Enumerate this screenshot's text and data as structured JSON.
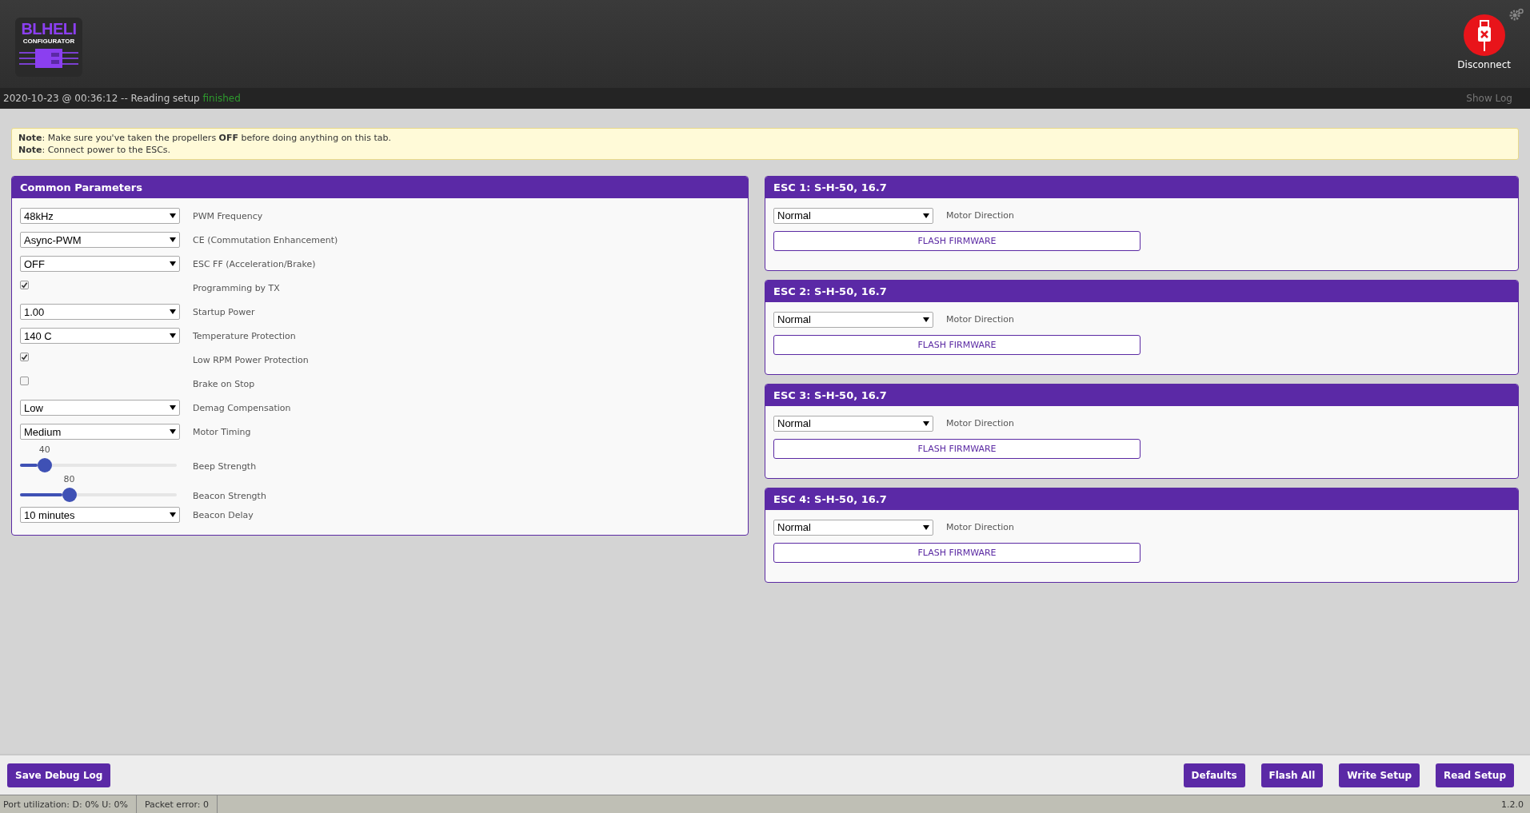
{
  "logo": {
    "title": "BLHELI",
    "subtitle": "CONFIGURATOR"
  },
  "connect_button": {
    "label": "Disconnect"
  },
  "log": {
    "text": "2020-10-23 @ 00:36:12 -- Reading setup",
    "status": "finished",
    "toggle": "Show Log"
  },
  "notes": [
    "**Note**: Make sure you've taken the propellers **OFF** before doing anything on this tab.",
    "**Note**: Connect power to the ESCs."
  ],
  "common": {
    "title": "Common Parameters",
    "params": [
      {
        "kind": "select",
        "value": "48kHz",
        "label": "PWM Frequency"
      },
      {
        "kind": "select",
        "value": "Async-PWM",
        "label": "CE (Commutation Enhancement)"
      },
      {
        "kind": "select",
        "value": "OFF",
        "label": "ESC FF (Acceleration/Brake)"
      },
      {
        "kind": "checkbox",
        "checked": true,
        "label": "Programming by TX"
      },
      {
        "kind": "select",
        "value": "1.00",
        "label": "Startup Power"
      },
      {
        "kind": "select",
        "value": "140 C",
        "label": "Temperature Protection"
      },
      {
        "kind": "checkbox",
        "checked": true,
        "label": "Low RPM Power Protection"
      },
      {
        "kind": "checkbox",
        "checked": false,
        "label": "Brake on Stop"
      },
      {
        "kind": "select",
        "value": "Low",
        "label": "Demag Compensation"
      },
      {
        "kind": "select",
        "value": "Medium",
        "label": "Motor Timing"
      },
      {
        "kind": "slider",
        "value": "40",
        "level": 0.157,
        "label": "Beep Strength"
      },
      {
        "kind": "slider",
        "value": "80",
        "level": 0.314,
        "label": "Beacon Strength"
      },
      {
        "kind": "select",
        "value": "10 minutes",
        "label": "Beacon Delay"
      }
    ]
  },
  "escs": [
    {
      "title": "ESC 1: S-H-50, 16.7",
      "direction": "Normal",
      "direction_label": "Motor Direction",
      "flash": "FLASH FIRMWARE"
    },
    {
      "title": "ESC 2: S-H-50, 16.7",
      "direction": "Normal",
      "direction_label": "Motor Direction",
      "flash": "FLASH FIRMWARE"
    },
    {
      "title": "ESC 3: S-H-50, 16.7",
      "direction": "Normal",
      "direction_label": "Motor Direction",
      "flash": "FLASH FIRMWARE"
    },
    {
      "title": "ESC 4: S-H-50, 16.7",
      "direction": "Normal",
      "direction_label": "Motor Direction",
      "flash": "FLASH FIRMWARE"
    }
  ],
  "toolbar": {
    "left": [
      "Save Debug Log"
    ],
    "right": [
      "Defaults",
      "Flash All",
      "Write Setup",
      "Read Setup"
    ]
  },
  "status_bar": {
    "items": [
      "Port utilization: D: 0% U: 0%",
      "Packet error: 0"
    ],
    "version": "1.2.0"
  }
}
